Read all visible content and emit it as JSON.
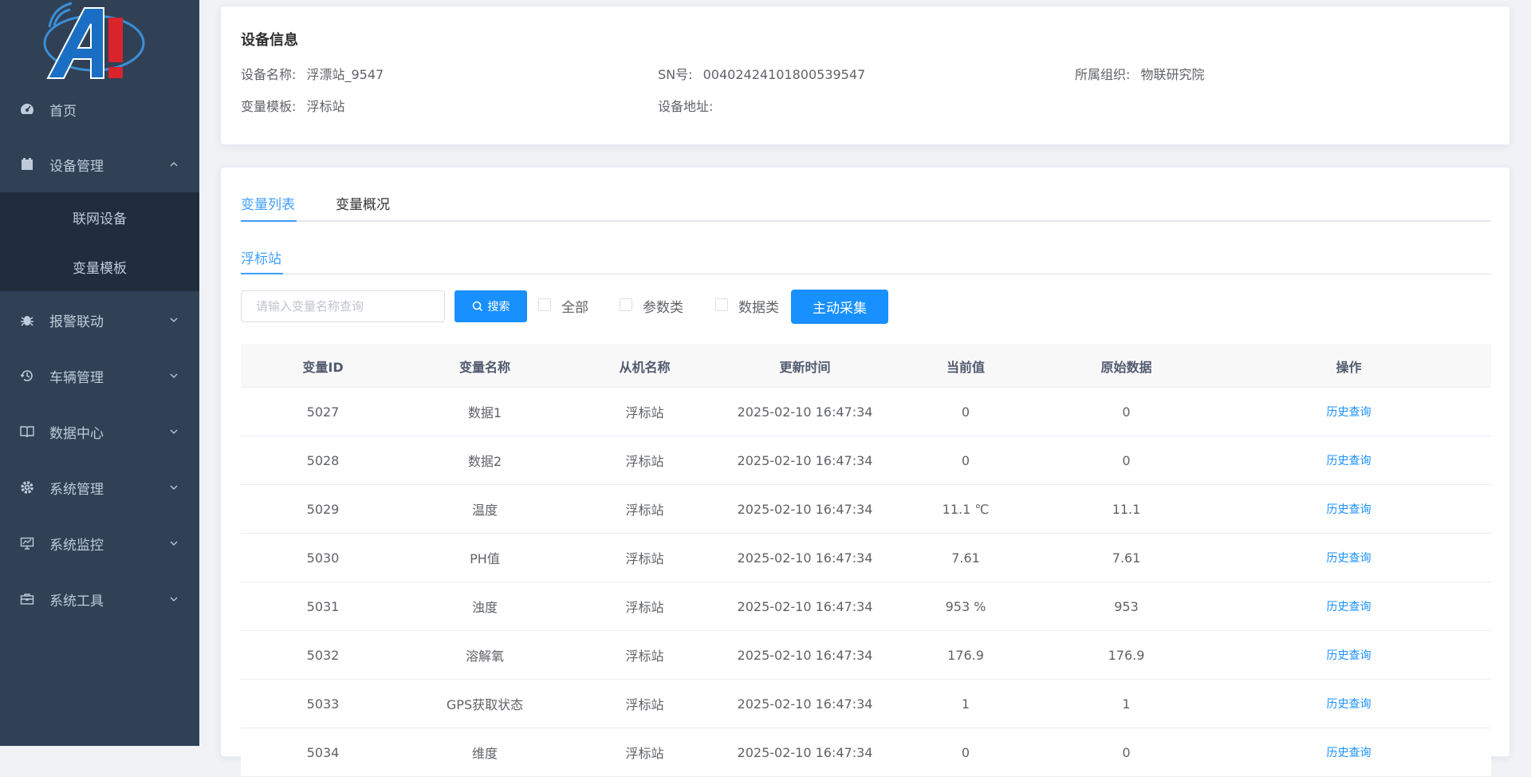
{
  "sidebar": {
    "menu": [
      {
        "label": "首页",
        "icon": "dashboard-icon"
      },
      {
        "label": "设备管理",
        "icon": "device-icon",
        "expanded": true
      },
      {
        "label": "报警联动",
        "icon": "bug-icon"
      },
      {
        "label": "车辆管理",
        "icon": "history-icon"
      },
      {
        "label": "数据中心",
        "icon": "book-icon"
      },
      {
        "label": "系统管理",
        "icon": "gear-icon"
      },
      {
        "label": "系统监控",
        "icon": "monitor-icon"
      },
      {
        "label": "系统工具",
        "icon": "toolbox-icon"
      }
    ],
    "submenu": [
      {
        "label": "联网设备"
      },
      {
        "label": "变量模板"
      }
    ]
  },
  "device_info": {
    "title": "设备信息",
    "name_label": "设备名称:",
    "name": "浮漂站_9547",
    "sn_label": "SN号:",
    "sn": "0040242410180053954​7",
    "org_label": "所属组织:",
    "org": "物联研究院",
    "template_label": "变量模板:",
    "template": "浮标站",
    "address_label": "设备地址:",
    "address": ""
  },
  "tabs": [
    {
      "label": "变量列表",
      "active": true
    },
    {
      "label": "变量概况",
      "active": false
    }
  ],
  "subtab": {
    "label": "浮标站"
  },
  "filters": {
    "search_placeholder": "请输入变量名称查询",
    "search_button": "搜索",
    "checkboxes": [
      {
        "label": "全部",
        "checked": false
      },
      {
        "label": "参数类",
        "checked": false
      },
      {
        "label": "数据类",
        "checked": false
      }
    ],
    "collect_button": "主动采集"
  },
  "table": {
    "columns": [
      "变量ID",
      "变量名称",
      "从机名称",
      "更新时间",
      "当前值",
      "原始数据",
      "操作"
    ],
    "rows": [
      {
        "id": "5027",
        "name": "数据1",
        "slave": "浮标站",
        "time": "2025-02-10 16:47:34",
        "value": "0",
        "raw": "0",
        "action": "历史查询"
      },
      {
        "id": "5028",
        "name": "数据2",
        "slave": "浮标站",
        "time": "2025-02-10 16:47:34",
        "value": "0",
        "raw": "0",
        "action": "历史查询"
      },
      {
        "id": "5029",
        "name": "温度",
        "slave": "浮标站",
        "time": "2025-02-10 16:47:34",
        "value": "11.1 ℃",
        "raw": "11.1",
        "action": "历史查询"
      },
      {
        "id": "5030",
        "name": "PH值",
        "slave": "浮标站",
        "time": "2025-02-10 16:47:34",
        "value": "7.61",
        "raw": "7.61",
        "action": "历史查询"
      },
      {
        "id": "5031",
        "name": "浊度",
        "slave": "浮标站",
        "time": "2025-02-10 16:47:34",
        "value": "953 %",
        "raw": "953",
        "action": "历史查询"
      },
      {
        "id": "5032",
        "name": "溶解氧",
        "slave": "浮标站",
        "time": "2025-02-10 16:47:34",
        "value": "176.9",
        "raw": "176.9",
        "action": "历史查询"
      },
      {
        "id": "5033",
        "name": "GPS获取状态",
        "slave": "浮标站",
        "time": "2025-02-10 16:47:34",
        "value": "1",
        "raw": "1",
        "action": "历史查询"
      },
      {
        "id": "5034",
        "name": "维度",
        "slave": "浮标站",
        "time": "2025-02-10 16:47:34",
        "value": "0",
        "raw": "0",
        "action": "历史查询"
      }
    ]
  },
  "colors": {
    "accent": "#1890ff",
    "sidebar_bg": "#304156",
    "submenu_bg": "#1f2d3d"
  }
}
